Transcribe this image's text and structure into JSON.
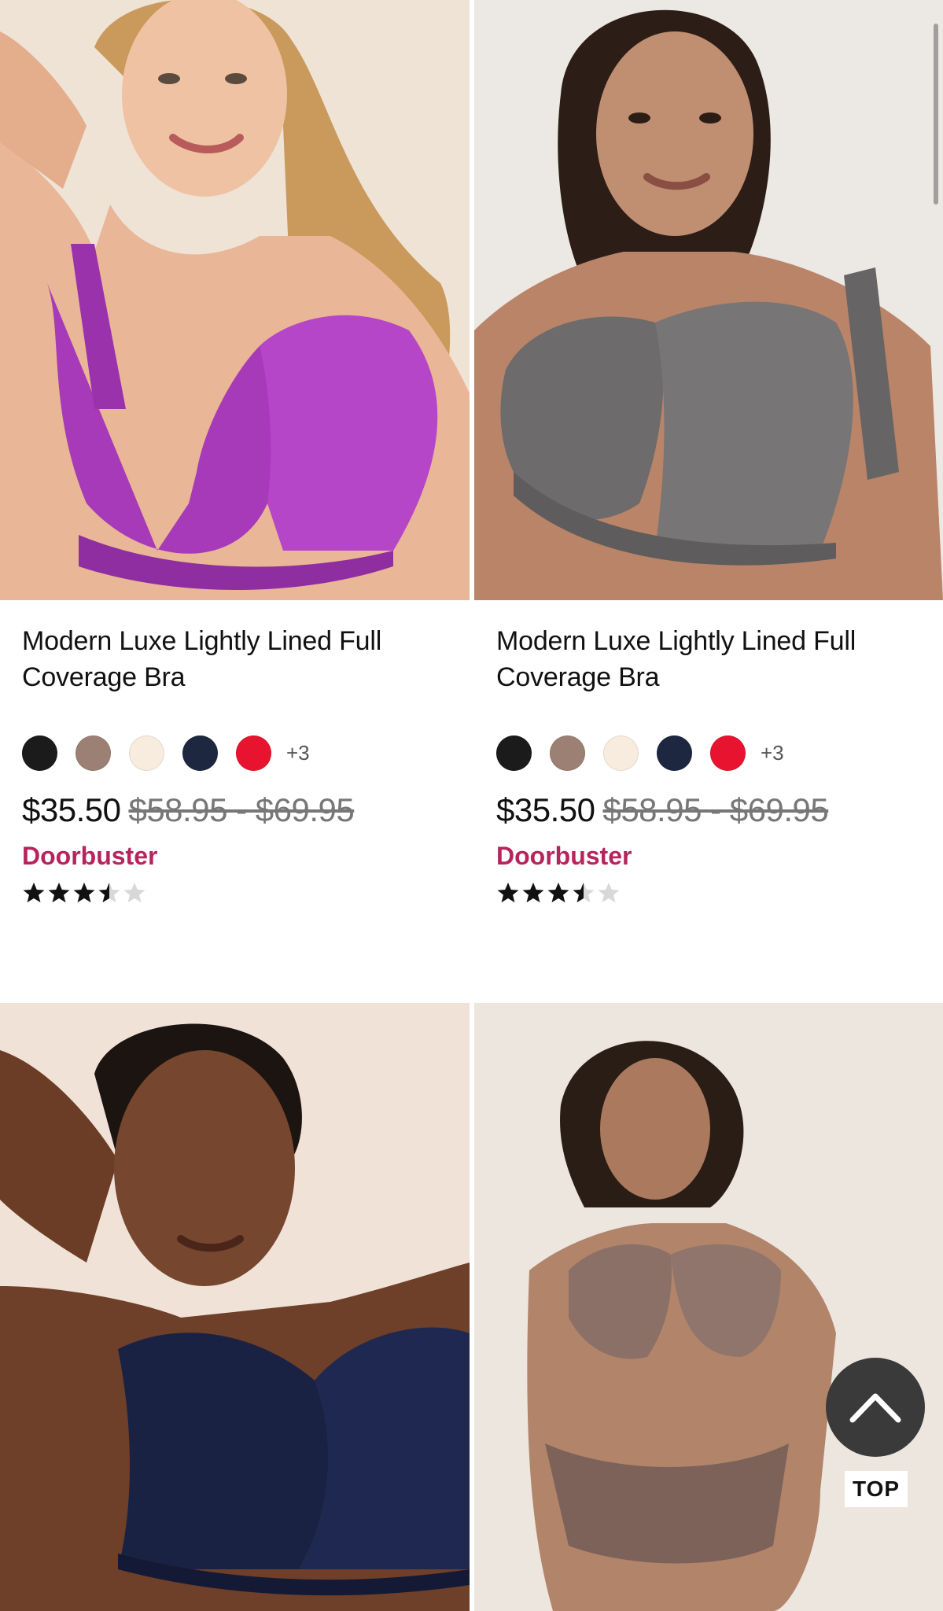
{
  "products": [
    {
      "title": "Modern Luxe Lightly Lined Full Coverage Bra",
      "swatch_colors": [
        "#1b1b1b",
        "#9c8074",
        "#f8ecdf",
        "#1e2740",
        "#e8142f"
      ],
      "more_colors": "+3",
      "price": "$35.50",
      "original_price": "$58.95 - $69.95",
      "promo": "Doorbuster",
      "rating": 3.5,
      "photo": {
        "bra_color": "#a63ab8",
        "background": "#efe3d6"
      }
    },
    {
      "title": "Modern Luxe Lightly Lined Full Coverage Bra",
      "swatch_colors": [
        "#1b1b1b",
        "#9c8074",
        "#f8ecdf",
        "#1e2740",
        "#e8142f"
      ],
      "more_colors": "+3",
      "price": "$35.50",
      "original_price": "$58.95 - $69.95",
      "promo": "Doorbuster",
      "rating": 3.5,
      "photo": {
        "bra_color": "#6d6b6b",
        "background": "#ece8e3"
      }
    }
  ],
  "next_row": [
    {
      "photo": {
        "bra_color": "#1a2244",
        "background": "#f1e2d7"
      }
    },
    {
      "photo": {
        "bra_color": "#8a7067",
        "background": "#ece6df"
      }
    }
  ],
  "back_to_top": {
    "label": "TOP"
  }
}
